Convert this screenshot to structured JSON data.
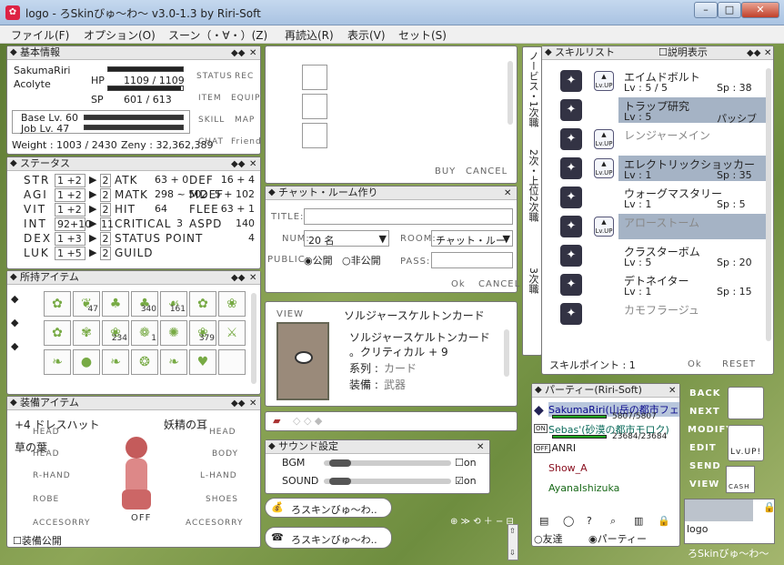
{
  "window": {
    "title": "logo - ろSkinびゅ～わ～ v3.0-1.3 by Riri-Soft",
    "min": "–",
    "max": "□",
    "close": "✕"
  },
  "menu": [
    "ファイル(F)",
    "オプション(O)",
    "スーン（・∀・）(Z)",
    "再読込(R)",
    "表示(V)",
    "セット(S)"
  ],
  "basic": {
    "header": "基本情報",
    "name": "SakumaRiri",
    "job": "Acolyte",
    "hp_label": "HP",
    "hp_text": "1109 / 1109",
    "hp_ratio": 1.0,
    "sp_label": "SP",
    "sp_text": "601 / 613",
    "sp_ratio": 0.98,
    "base_lv": "Base Lv. 60",
    "job_lv": "Job Lv. 47",
    "weight": "Weight : 1003 / 2430",
    "zeny": "Zeny : 32,362,389",
    "side": [
      "STATUS",
      "REC",
      "ITEM",
      "EQUIP",
      "SKILL",
      "MAP",
      "CHAT",
      "Friend"
    ]
  },
  "status": {
    "header": "ステータス",
    "stats": [
      {
        "n": "STR",
        "v": "1 +2",
        "p": "2"
      },
      {
        "n": "AGI",
        "v": "1 +2",
        "p": "2"
      },
      {
        "n": "VIT",
        "v": "1 +2",
        "p": "2"
      },
      {
        "n": "INT",
        "v": "92+10",
        "p": "11"
      },
      {
        "n": "DEX",
        "v": "1 +3",
        "p": "2"
      },
      {
        "n": "LUK",
        "v": "1 +5",
        "p": "2"
      }
    ],
    "rows": [
      {
        "a": "ATK",
        "av": "63 + 0",
        "b": "DEF",
        "bv": "16 + 4"
      },
      {
        "a": "MATK",
        "av": "298 ~ 502",
        "b": "MDEF",
        "bv": "5 + 102"
      },
      {
        "a": "HIT",
        "av": "64",
        "b": "FLEE",
        "bv": "63 + 1"
      },
      {
        "a": "CRITICAL",
        "av": "3",
        "b": "ASPD",
        "bv": "140"
      },
      {
        "a": "STATUS POINT",
        "av": "",
        "b": "",
        "bv": "4"
      },
      {
        "a": "GUILD",
        "av": "",
        "b": "",
        "bv": ""
      }
    ]
  },
  "items": {
    "header": "所持アイテム",
    "cells": [
      {
        "i": "✿",
        "c": ""
      },
      {
        "i": "❦",
        "c": "47"
      },
      {
        "i": "♣",
        "c": ""
      },
      {
        "i": "♣",
        "c": "340"
      },
      {
        "i": "☙",
        "c": "161"
      },
      {
        "i": "✿",
        "c": ""
      },
      {
        "i": "❀",
        "c": ""
      },
      {
        "i": "✿",
        "c": ""
      },
      {
        "i": "✾",
        "c": ""
      },
      {
        "i": "❀",
        "c": "234"
      },
      {
        "i": "❁",
        "c": "1"
      },
      {
        "i": "✺",
        "c": ""
      },
      {
        "i": "❀",
        "c": "379"
      },
      {
        "i": "⚔",
        "c": ""
      },
      {
        "i": "❧",
        "c": ""
      },
      {
        "i": "●",
        "c": ""
      },
      {
        "i": "❧",
        "c": ""
      },
      {
        "i": "❂",
        "c": ""
      },
      {
        "i": "❧",
        "c": ""
      },
      {
        "i": "♥",
        "c": ""
      },
      {
        "i": "",
        "c": ""
      }
    ]
  },
  "equip": {
    "header": "装備アイテム",
    "head_item": "+4 ドレスハット",
    "fairy": "妖精の耳",
    "leaf": "草の葉",
    "slots": [
      "HEAD",
      "HEAD",
      "HEAD",
      "BODY",
      "R-HAND",
      "L-HAND",
      "ROBE",
      "SHOES",
      "ACCESORRY",
      "ACCESORRY"
    ],
    "off": "OFF",
    "public": "装備公開"
  },
  "shop": {
    "buy": "BUY",
    "cancel": "CANCEL"
  },
  "chatroom": {
    "header": "チャット・ルーム作り",
    "title_label": "TITLE:",
    "num_label": "NUM:",
    "num_value": "20 名",
    "room_label": "ROOM:",
    "room_value": "チャット・ルー",
    "public_label": "PUBLIC:",
    "pub_on": "公開",
    "pub_off": "非公開",
    "pass_label": "PASS:",
    "ok": "Ok",
    "cancel": "CANCEL"
  },
  "card": {
    "view": "VIEW",
    "name": "ソルジャースケルトンカード",
    "line1": "ソルジャースケルトンカード",
    "line2": "。クリティカル + 9",
    "line3a": "系列 :",
    "line3b": "カード",
    "line4a": "装備 :",
    "line4b": "武器"
  },
  "sound": {
    "header": "サウンド設定",
    "bgm": "BGM",
    "sound": "SOUND",
    "on": "on",
    "bgm_level": 0.05,
    "sound_level": 0.05
  },
  "tabs": [
    "ろスキンびゅ～わ..",
    "ろスキンびゅ～わ.."
  ],
  "skill": {
    "header": "スキルリスト",
    "desc": "説明表示",
    "tabs": [
      "ノービス・1次職",
      "2次・上位2次職",
      "3次職"
    ],
    "list": [
      {
        "name": "エイムドボルト",
        "lv": "Lv :  5  /  5",
        "sp": "Sp : 38",
        "up": true,
        "sel": false
      },
      {
        "name": "トラップ研究",
        "lv": "Lv : 5",
        "sp": "パッシブ",
        "up": false,
        "sel": true
      },
      {
        "name": "レンジャーメイン",
        "lv": "",
        "sp": "",
        "up": true,
        "sel": false
      },
      {
        "name": "エレクトリックショッカー",
        "lv": "Lv : 1",
        "sp": "Sp : 35",
        "up": true,
        "sel": true
      },
      {
        "name": "ウォーグマスタリー",
        "lv": "Lv : 1",
        "sp": "Sp : 5",
        "up": false,
        "sel": false
      },
      {
        "name": "アローストーム",
        "lv": "",
        "sp": "",
        "up": true,
        "sel": true
      },
      {
        "name": "クラスターボム",
        "lv": "Lv : 5",
        "sp": "Sp : 20",
        "up": false,
        "sel": false
      },
      {
        "name": "デトネイター",
        "lv": "Lv : 1",
        "sp": "Sp : 15",
        "up": false,
        "sel": false
      },
      {
        "name": "カモフラージュ",
        "lv": "",
        "sp": "",
        "up": false,
        "sel": false
      }
    ],
    "points": "スキルポイント : 1",
    "ok": "Ok",
    "reset": "RESET"
  },
  "party": {
    "header": "パーティー(Riri-Soft)",
    "members": [
      {
        "n": "SakumaRiri(山岳の都市フェ",
        "hp": "5807/5807",
        "color": "#0a0a8c"
      },
      {
        "n": "Sebas'(砂漠の都市モロク)",
        "hp": "23684/23684",
        "color": "#0a6a5a"
      },
      {
        "n": ".ANRI",
        "hp": "",
        "color": "#222"
      },
      {
        "n": "Show_A",
        "hp": "",
        "color": "#8a1020"
      },
      {
        "n": "AyanaIshizuka",
        "hp": "",
        "color": "#1a6a1a"
      }
    ],
    "friend": "友達",
    "party": "パーティー"
  },
  "right": {
    "buttons": [
      "BACK",
      "NEXT",
      "MODIFY",
      "EDIT",
      "SEND",
      "VIEW"
    ],
    "lvup": "Lv.UP!",
    "cash": "CASH",
    "logo": "logo",
    "footer": "ろSkinびゅ～わ～"
  }
}
